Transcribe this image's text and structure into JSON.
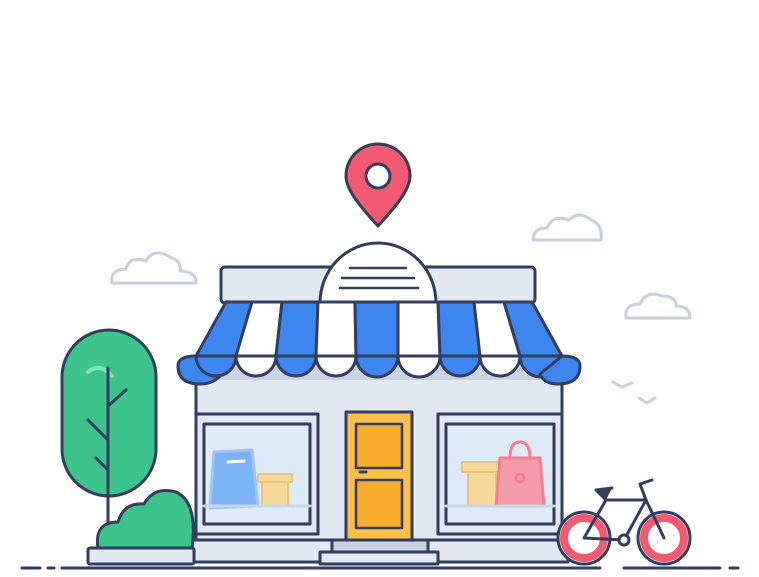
{
  "illustration": {
    "subject": "storefront",
    "icons": [
      "location-pin-icon",
      "cloud-icon",
      "tree-icon",
      "bush-icon",
      "shopping-bag-icon",
      "box-icon",
      "bicycle-icon",
      "bird-icon"
    ]
  },
  "colors": {
    "outline": "#333d5e",
    "awning_blue": "#3d86f0",
    "awning_white": "#ffffff",
    "wall": "#e1e8f2",
    "wall_shadow": "#c9d4e3",
    "window_glass": "#dfeaf8",
    "door": "#fcbf4a",
    "pin": "#f25a72",
    "tree": "#3cc48c",
    "bicycle_wheel": "#f25a72",
    "cloud": "#c8cfdd"
  }
}
